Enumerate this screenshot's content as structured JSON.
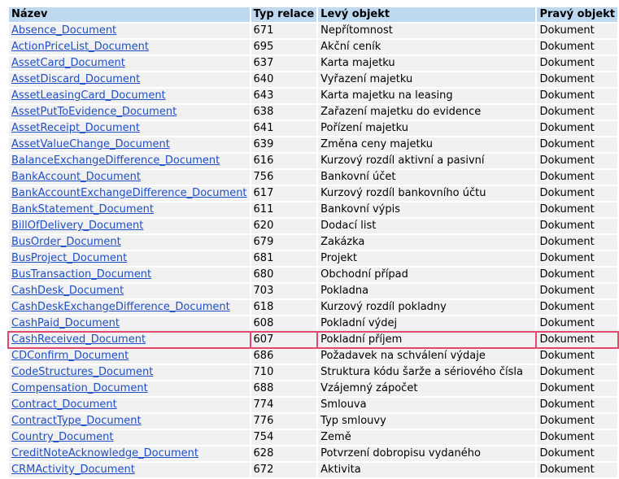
{
  "headers": {
    "name": "Název",
    "type": "Typ relace",
    "left": "Levý objekt",
    "right": "Pravý objekt"
  },
  "highlight_color": "#e2486e",
  "rows": [
    {
      "name": "Absence_Document",
      "type": "671",
      "left": "Nepřítomnost",
      "right": "Dokument"
    },
    {
      "name": "ActionPriceList_Document",
      "type": "695",
      "left": "Akční ceník",
      "right": "Dokument"
    },
    {
      "name": "AssetCard_Document",
      "type": "637",
      "left": "Karta majetku",
      "right": "Dokument"
    },
    {
      "name": "AssetDiscard_Document",
      "type": "640",
      "left": "Vyřazení majetku",
      "right": "Dokument"
    },
    {
      "name": "AssetLeasingCard_Document",
      "type": "643",
      "left": "Karta majetku na leasing",
      "right": "Dokument"
    },
    {
      "name": "AssetPutToEvidence_Document",
      "type": "638",
      "left": "Zařazení majetku do evidence",
      "right": "Dokument"
    },
    {
      "name": "AssetReceipt_Document",
      "type": "641",
      "left": "Pořízení majetku",
      "right": "Dokument"
    },
    {
      "name": "AssetValueChange_Document",
      "type": "639",
      "left": "Změna ceny majetku",
      "right": "Dokument"
    },
    {
      "name": "BalanceExchangeDifference_Document",
      "type": "616",
      "left": "Kurzový rozdíl aktivní a pasivní",
      "right": "Dokument"
    },
    {
      "name": "BankAccount_Document",
      "type": "756",
      "left": "Bankovní účet",
      "right": "Dokument"
    },
    {
      "name": "BankAccountExchangeDifference_Document",
      "type": "617",
      "left": "Kurzový rozdíl bankovního účtu",
      "right": "Dokument"
    },
    {
      "name": "BankStatement_Document",
      "type": "611",
      "left": "Bankovní výpis",
      "right": "Dokument"
    },
    {
      "name": "BillOfDelivery_Document",
      "type": "620",
      "left": "Dodací list",
      "right": "Dokument"
    },
    {
      "name": "BusOrder_Document",
      "type": "679",
      "left": "Zakázka",
      "right": "Dokument"
    },
    {
      "name": "BusProject_Document",
      "type": "681",
      "left": "Projekt",
      "right": "Dokument"
    },
    {
      "name": "BusTransaction_Document",
      "type": "680",
      "left": "Obchodní případ",
      "right": "Dokument"
    },
    {
      "name": "CashDesk_Document",
      "type": "703",
      "left": "Pokladna",
      "right": "Dokument"
    },
    {
      "name": "CashDeskExchangeDifference_Document",
      "type": "618",
      "left": "Kurzový rozdíl pokladny",
      "right": "Dokument"
    },
    {
      "name": "CashPaid_Document",
      "type": "608",
      "left": "Pokladní výdej",
      "right": "Dokument"
    },
    {
      "name": "CashReceived_Document",
      "type": "607",
      "left": "Pokladní příjem",
      "right": "Dokument",
      "highlighted": true
    },
    {
      "name": "CDConfirm_Document",
      "type": "686",
      "left": "Požadavek na schválení výdaje",
      "right": "Dokument"
    },
    {
      "name": "CodeStructures_Document",
      "type": "710",
      "left": "Struktura kódu šarže a sériového čísla",
      "right": "Dokument"
    },
    {
      "name": "Compensation_Document",
      "type": "688",
      "left": "Vzájemný zápočet",
      "right": "Dokument"
    },
    {
      "name": "Contract_Document",
      "type": "774",
      "left": "Smlouva",
      "right": "Dokument"
    },
    {
      "name": "ContractType_Document",
      "type": "776",
      "left": "Typ smlouvy",
      "right": "Dokument"
    },
    {
      "name": "Country_Document",
      "type": "754",
      "left": "Země",
      "right": "Dokument"
    },
    {
      "name": "CreditNoteAcknowledge_Document",
      "type": "628",
      "left": "Potvrzení dobropisu vydaného",
      "right": "Dokument"
    },
    {
      "name": "CRMActivity_Document",
      "type": "672",
      "left": "Aktivita",
      "right": "Dokument"
    }
  ]
}
